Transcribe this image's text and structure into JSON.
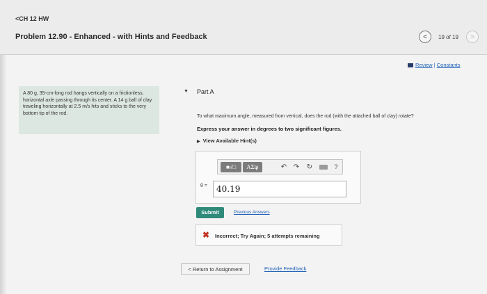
{
  "header": {
    "back_label": "<CH 12 HW",
    "problem_title": "Problem 12.90 - Enhanced - with Hints and Feedback",
    "nav_prev_icon": "chevron-left-icon",
    "nav_next_icon": "chevron-right-icon",
    "nav_prev_glyph": "<",
    "nav_next_glyph": ">",
    "nav_count": "19 of 19"
  },
  "review": {
    "review_label": "Review",
    "separator": "|",
    "constants_label": "Constants"
  },
  "problem_statement": "A 80 g, 35-cm-long rod hangs vertically on a frictionless, horizontal axle passing through its center. A 14 g ball of clay traveling horizontally at 2.5 m/s hits and sticks to the very bottom tip of the rod.",
  "part": {
    "label": "Part A",
    "question": "To what maximum angle, measured from vertical, does the rod (with the attached ball of clay) rotate?",
    "instruction": "Express your answer in degrees to two significant figures.",
    "hints_label": "View Available Hint(s)"
  },
  "toolbar": {
    "templates_label": "■√□",
    "symbols_label": "AΣφ",
    "undo_glyph": "↶",
    "redo_glyph": "↷",
    "reset_glyph": "↻",
    "help_glyph": "?"
  },
  "answer": {
    "variable_label": "θ =",
    "value": "40.19"
  },
  "actions": {
    "submit_label": "Submit",
    "previous_answers_label": "Previous Answers"
  },
  "feedback": {
    "icon": "x-icon",
    "glyph": "✖",
    "message": "Incorrect; Try Again; 5 attempts remaining"
  },
  "footer": {
    "return_label": "< Return to Assignment",
    "provide_feedback_label": "Provide Feedback"
  },
  "colors": {
    "submit_bg": "#2f8a7a",
    "link": "#1d5fb8",
    "error": "#c0301f",
    "problem_box_bg": "#dde7e2"
  }
}
